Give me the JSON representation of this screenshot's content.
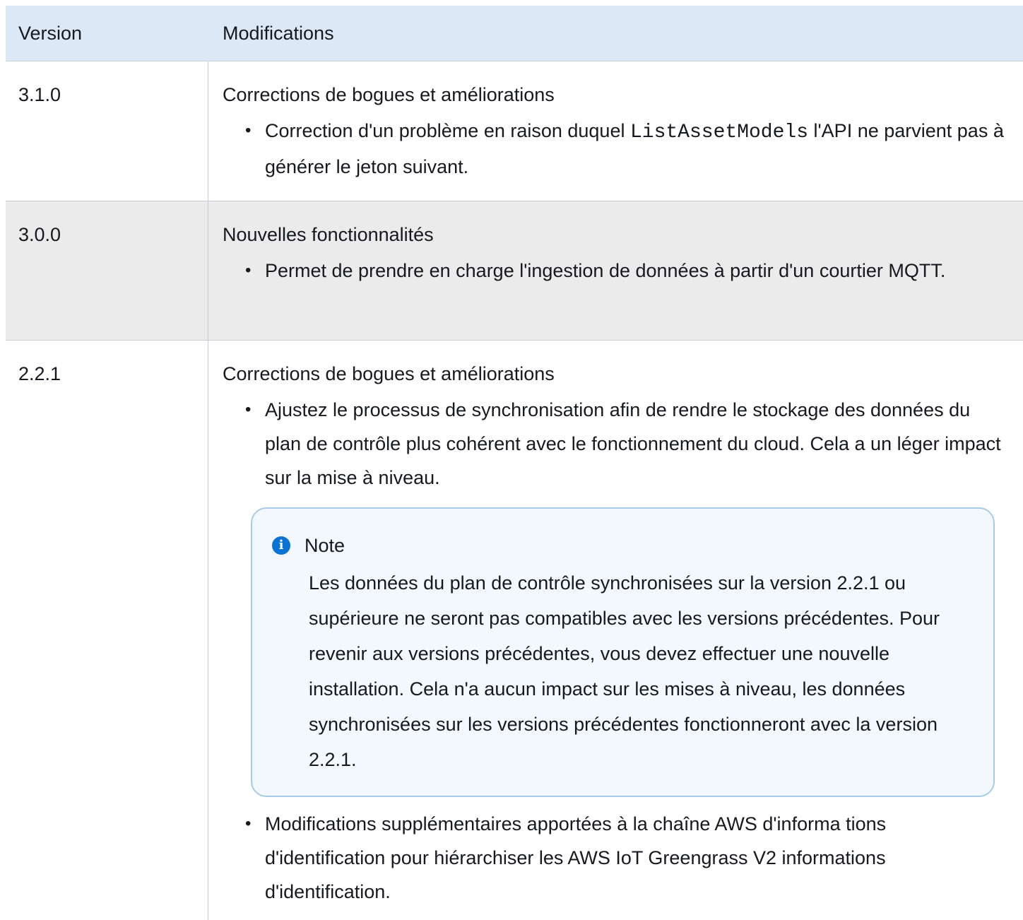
{
  "header": {
    "version": "Version",
    "modifications": "Modifications"
  },
  "rows": [
    {
      "version": "3.1.0",
      "title": "Corrections de bogues et améliorations",
      "item1_pre": "Correction d'un problème en raison duquel ",
      "item1_code": "ListAssetModels",
      "item1_post": " l'API ne parvient pas à générer le jeton suivant."
    },
    {
      "version": "3.0.0",
      "title": "Nouvelles fonctionnalités",
      "item1": "Permet de prendre en charge l'ingestion de données à partir d'un courtier MQTT."
    },
    {
      "version": "2.2.1",
      "title": "Corrections de bogues et améliorations",
      "item1": "Ajustez le processus de synchronisation afin de rendre le stockage des données du plan de contrôle plus cohérent avec le fonctionnement du cloud. Cela a un léger impact sur la mise à niveau.",
      "note_title": "Note",
      "note_body": "Les données du plan de contrôle synchronisées sur la version 2.2.1 ou supérieure ne seront pas compatibles avec les versions précédentes. Pour revenir aux versions précédentes, vous devez effectuer une nouvelle installation. Cela n'a aucun impact sur les mises à niveau, les données synchronisées sur les versions précédentes fonctionneront avec la version 2.2.1.",
      "item2": "Modifications supplémentaires apportées à la chaîne AWS d'informa tions d'identification pour hiérarchiser les AWS IoT Greengrass V2 informations d'identification."
    }
  ]
}
